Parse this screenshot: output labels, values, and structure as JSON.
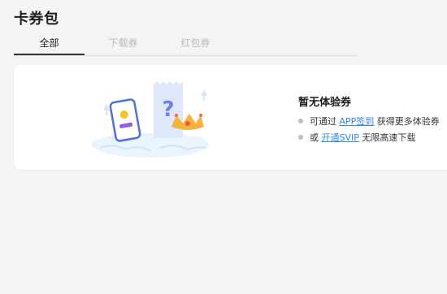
{
  "page": {
    "title": "卡券包"
  },
  "tabs": [
    {
      "label": "全部",
      "active": true
    },
    {
      "label": "下载券",
      "active": false
    },
    {
      "label": "红包券",
      "active": false
    }
  ],
  "empty_state": {
    "title": "暂无体验券",
    "hint1": {
      "prefix": "可通过 ",
      "link": "APP签到",
      "suffix": " 获得更多体验券"
    },
    "hint2": {
      "prefix": "或 ",
      "link": "开通SVIP",
      "suffix": " 无限高速下载"
    },
    "illustration_icon": "empty-coupon-illustration"
  },
  "colors": {
    "link": "#2f8ae0",
    "active_tab": "#333333",
    "inactive_tab": "#b9b9b9",
    "background": "#f4f4f4"
  }
}
